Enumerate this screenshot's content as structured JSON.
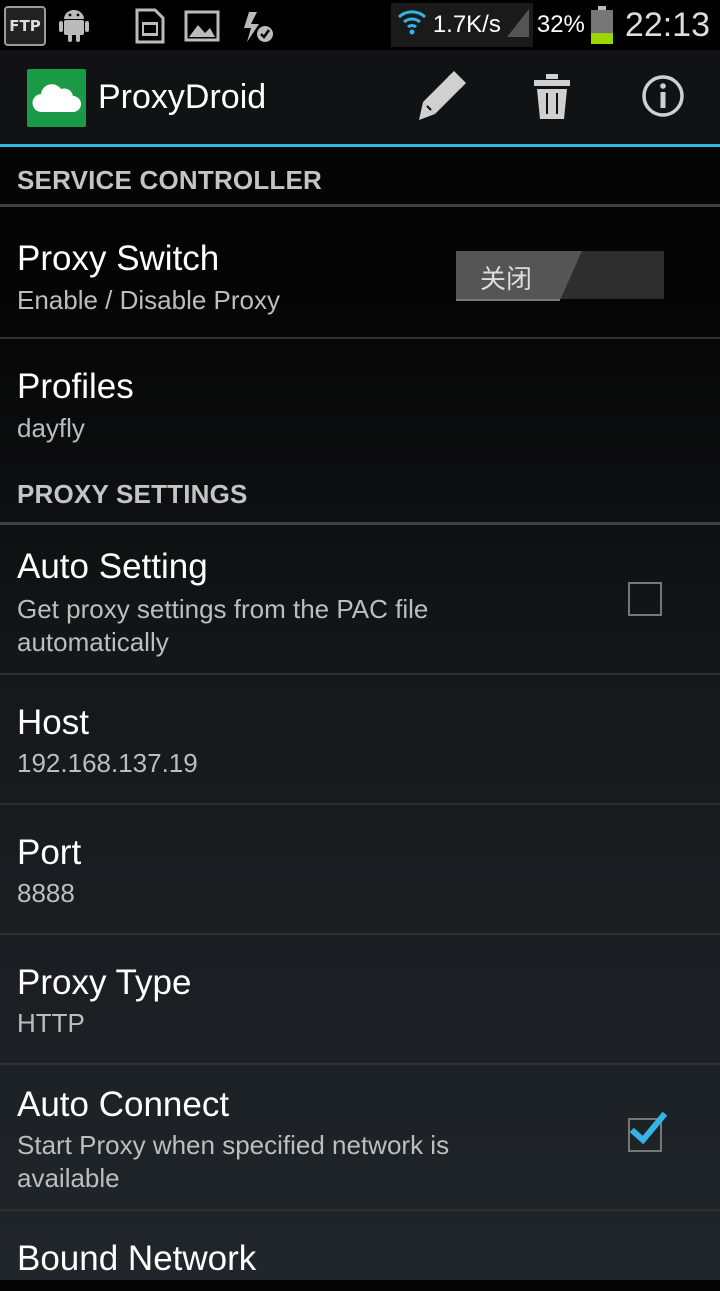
{
  "status_bar": {
    "ftp_label": "FTP",
    "net_speed": "1.7K/s",
    "battery_percent": "32%",
    "battery_level": 0.32,
    "time": "22:13",
    "icons": [
      "ftp-icon",
      "android-icon",
      "sd-card-icon",
      "image-icon",
      "sync-ok-icon",
      "wifi-icon",
      "signal-icon",
      "battery-icon"
    ]
  },
  "action_bar": {
    "title": "ProxyDroid",
    "logo_icon": "cloud-icon",
    "actions": [
      {
        "name": "edit",
        "icon": "pencil-icon"
      },
      {
        "name": "delete",
        "icon": "trash-icon"
      },
      {
        "name": "about",
        "icon": "info-icon"
      }
    ],
    "accent_color": "#33b5e5",
    "logo_color": "#1a9a47"
  },
  "sections": {
    "service_controller": "SERVICE CONTROLLER",
    "proxy_settings": "PROXY SETTINGS"
  },
  "prefs": {
    "proxy_switch": {
      "title": "Proxy Switch",
      "summary": "Enable / Disable Proxy",
      "switch_text": "关闭",
      "enabled": false
    },
    "profiles": {
      "title": "Profiles",
      "summary": "dayfly"
    },
    "auto_setting": {
      "title": "Auto Setting",
      "summary": "Get proxy settings from the PAC file automatically",
      "checked": false
    },
    "host": {
      "title": "Host",
      "summary": "192.168.137.19"
    },
    "port": {
      "title": "Port",
      "summary": "8888"
    },
    "proxy_type": {
      "title": "Proxy Type",
      "summary": "HTTP"
    },
    "auto_connect": {
      "title": "Auto Connect",
      "summary": "Start Proxy when specified network is available",
      "checked": true
    },
    "bound_network": {
      "title": "Bound Network"
    }
  }
}
